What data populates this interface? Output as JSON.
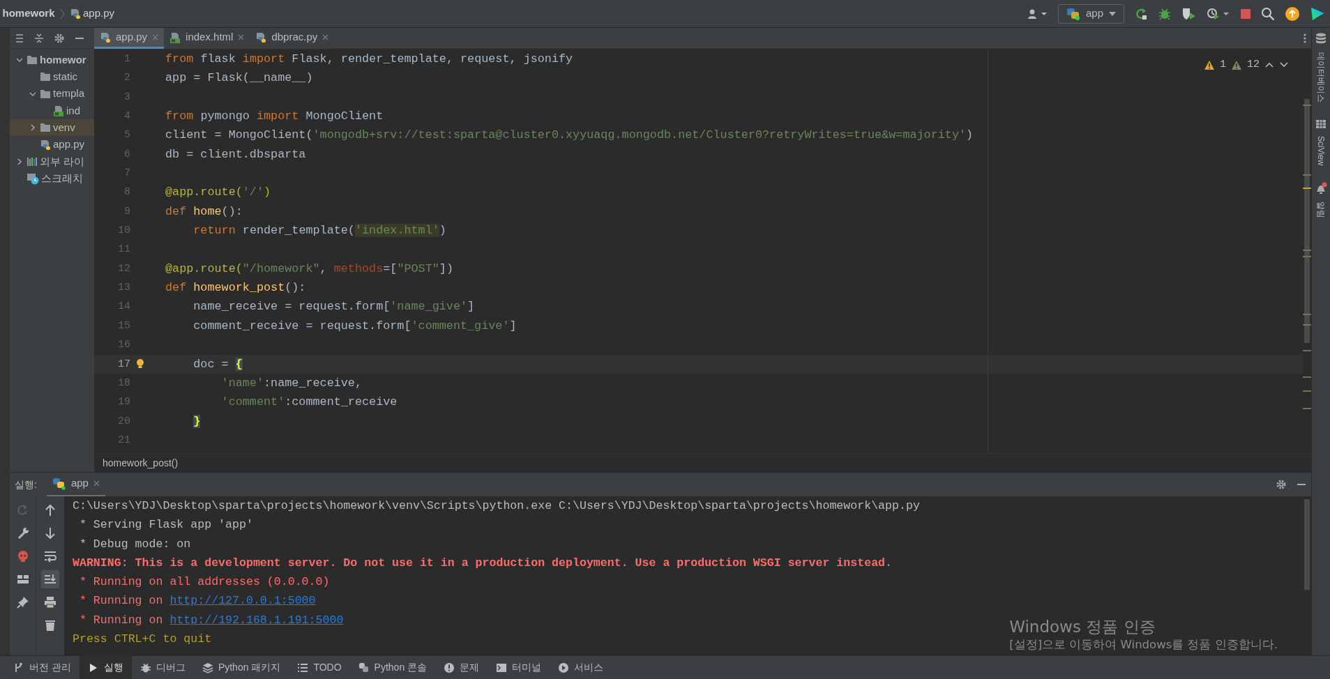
{
  "breadcrumb": [
    {
      "label": "homework",
      "kind": "project"
    },
    {
      "label": "app.py",
      "kind": "python"
    }
  ],
  "run_config": "app",
  "project_tree": [
    {
      "label": "homewor",
      "kind": "folder",
      "expanded": true,
      "selected": false,
      "children": [
        {
          "label": "static",
          "kind": "empty-folder",
          "selected": false
        },
        {
          "label": "templa",
          "kind": "folder",
          "expanded": true,
          "selected": false,
          "children": [
            {
              "label": "ind",
              "kind": "html",
              "selected": false
            }
          ]
        },
        {
          "label": "venv",
          "kind": "folder",
          "expanded": false,
          "selected": true
        },
        {
          "label": "app.py",
          "kind": "python",
          "selected": false
        }
      ]
    },
    {
      "label": "외부 라이",
      "kind": "library",
      "expanded": false,
      "selected": false
    },
    {
      "label": "스크래치",
      "kind": "scratch",
      "selected": false
    }
  ],
  "editor_tabs": [
    {
      "label": "app.py",
      "kind": "python",
      "selected": true
    },
    {
      "label": "index.html",
      "kind": "html",
      "selected": false
    },
    {
      "label": "dbprac.py",
      "kind": "python",
      "selected": false
    }
  ],
  "inspections": {
    "warnings": "1",
    "weak_warnings": "12"
  },
  "code_lines": [
    {
      "number": "1",
      "current": false,
      "tokens": [
        {
          "text": "from",
          "kind": "keyword"
        },
        {
          "text": " flask ",
          "kind": "plain"
        },
        {
          "text": "import",
          "kind": "keyword"
        },
        {
          "text": " Flask, render_template, request, jsonify",
          "kind": "plain"
        }
      ]
    },
    {
      "number": "2",
      "current": false,
      "tokens": [
        {
          "text": "app = Flask(__name__)",
          "kind": "plain"
        }
      ]
    },
    {
      "number": "3",
      "current": false
    },
    {
      "number": "4",
      "current": false,
      "tokens": [
        {
          "text": "from",
          "kind": "keyword"
        },
        {
          "text": " pymongo ",
          "kind": "plain"
        },
        {
          "text": "import",
          "kind": "keyword"
        },
        {
          "text": " MongoClient",
          "kind": "plain"
        }
      ]
    },
    {
      "number": "5",
      "current": false,
      "tokens": [
        {
          "text": "client = MongoClient(",
          "kind": "plain"
        },
        {
          "text": "'mongodb+srv://test:sparta@cluster0.xyyuaqg.mongodb.net/Cluster0?retryWrites=true&w=majority'",
          "kind": "string"
        },
        {
          "text": ")",
          "kind": "plain"
        }
      ]
    },
    {
      "number": "6",
      "current": false,
      "tokens": [
        {
          "text": "db = client.dbsparta",
          "kind": "plain"
        }
      ]
    },
    {
      "number": "7",
      "current": false
    },
    {
      "number": "8",
      "current": false,
      "tokens": [
        {
          "text": "@app.route(",
          "kind": "decorator"
        },
        {
          "text": "'/'",
          "kind": "string"
        },
        {
          "text": ")",
          "kind": "decorator"
        }
      ]
    },
    {
      "number": "9",
      "current": false,
      "tokens": [
        {
          "text": "def",
          "kind": "keyword"
        },
        {
          "text": " home",
          "kind": "function"
        },
        {
          "text": "():",
          "kind": "plain"
        }
      ]
    },
    {
      "number": "10",
      "current": false,
      "tokens": [
        {
          "text": "    return",
          "kind": "keyword"
        },
        {
          "text": " render_template(",
          "kind": "plain"
        },
        {
          "text": "'index.html'",
          "kind": "match"
        },
        {
          "text": ")",
          "kind": "plain"
        }
      ]
    },
    {
      "number": "11",
      "current": false
    },
    {
      "number": "12",
      "current": false,
      "tokens": [
        {
          "text": "@app.route(",
          "kind": "decorator"
        },
        {
          "text": "\"/homework\"",
          "kind": "string"
        },
        {
          "text": ", ",
          "kind": "plain"
        },
        {
          "text": "methods",
          "kind": "param"
        },
        {
          "text": "=[",
          "kind": "plain"
        },
        {
          "text": "\"POST\"",
          "kind": "string"
        },
        {
          "text": "])",
          "kind": "plain"
        }
      ]
    },
    {
      "number": "13",
      "current": false,
      "tokens": [
        {
          "text": "def",
          "kind": "keyword"
        },
        {
          "text": " homework_post",
          "kind": "function"
        },
        {
          "text": "():",
          "kind": "plain"
        }
      ]
    },
    {
      "number": "14",
      "current": false,
      "tokens": [
        {
          "text": "    name_receive = request.form[",
          "kind": "plain"
        },
        {
          "text": "'name_give'",
          "kind": "string"
        },
        {
          "text": "]",
          "kind": "plain"
        }
      ]
    },
    {
      "number": "15",
      "current": false,
      "tokens": [
        {
          "text": "    comment_receive = request.form[",
          "kind": "plain"
        },
        {
          "text": "'comment_give'",
          "kind": "string"
        },
        {
          "text": "]",
          "kind": "plain"
        }
      ]
    },
    {
      "number": "16",
      "current": false
    },
    {
      "number": "17",
      "current": true,
      "tokens": [
        {
          "text": "    doc = ",
          "kind": "plain"
        },
        {
          "text": "{",
          "kind": "brace"
        }
      ]
    },
    {
      "number": "18",
      "current": false,
      "tokens": [
        {
          "text": "        'name'",
          "kind": "string"
        },
        {
          "text": ":name_receive,",
          "kind": "plain"
        }
      ]
    },
    {
      "number": "19",
      "current": false,
      "tokens": [
        {
          "text": "        'comment'",
          "kind": "string"
        },
        {
          "text": ":comment_receive",
          "kind": "plain"
        }
      ]
    },
    {
      "number": "20",
      "current": false,
      "tokens": [
        {
          "text": "    }",
          "kind": "brace"
        }
      ]
    },
    {
      "number": "21",
      "current": false
    }
  ],
  "structure_path": "homework_post()",
  "run_panel": {
    "label": "실행:",
    "tabs": [
      {
        "label": "app",
        "selected": true
      }
    ],
    "scroll_to_end": true,
    "console": [
      {
        "tokens": [
          {
            "text": "C:\\Users\\YDJ\\Desktop\\sparta\\projects\\homework\\venv\\Scripts\\python.exe C:\\Users\\YDJ\\Desktop\\sparta\\projects\\homework\\app.py",
            "kind": "plain"
          }
        ]
      },
      {
        "tokens": [
          {
            "text": " * Serving Flask app 'app'",
            "kind": "plain"
          }
        ]
      },
      {
        "tokens": [
          {
            "text": " * Debug mode: on",
            "kind": "plain"
          }
        ]
      },
      {
        "tokens": [
          {
            "text": "WARNING: This is a development server. Do not use it in a production deployment. Use a production WSGI server instead.",
            "kind": "warning"
          }
        ]
      },
      {
        "tokens": [
          {
            "text": " * Running on all addresses (0.0.0.0)",
            "kind": "error"
          }
        ]
      },
      {
        "tokens": [
          {
            "text": " * Running on ",
            "kind": "error"
          },
          {
            "text": "http://127.0.0.1:5000",
            "kind": "link"
          }
        ]
      },
      {
        "tokens": [
          {
            "text": " * Running on ",
            "kind": "error"
          },
          {
            "text": "http://192.168.1.191:5000",
            "kind": "link"
          }
        ]
      },
      {
        "tokens": [
          {
            "text": "Press CTRL+C to quit",
            "kind": "info"
          }
        ]
      }
    ]
  },
  "activation": {
    "title": "Windows 정품 인증",
    "text": "[설정]으로 이동하여 Windows를 정품 인증합니다."
  },
  "tool_windows": [
    {
      "label": "버전 관리",
      "kind": "vcs",
      "selected": false
    },
    {
      "label": "실행",
      "kind": "run",
      "selected": true
    },
    {
      "label": "디버그",
      "kind": "debug",
      "selected": false
    },
    {
      "label": "Python 패키지",
      "kind": "packages",
      "selected": false
    },
    {
      "label": "TODO",
      "kind": "todo",
      "selected": false
    },
    {
      "label": "Python 콘솔",
      "kind": "console",
      "selected": false
    },
    {
      "label": "문제",
      "kind": "problems",
      "selected": false
    },
    {
      "label": "터미널",
      "kind": "terminal",
      "selected": false
    },
    {
      "label": "서비스",
      "kind": "services",
      "selected": false
    }
  ],
  "right_sidebar": [
    {
      "label": "데이터베이스",
      "kind": "database"
    },
    {
      "label": "SciView",
      "kind": "sciview"
    },
    {
      "label": "알림",
      "kind": "notifications"
    }
  ]
}
